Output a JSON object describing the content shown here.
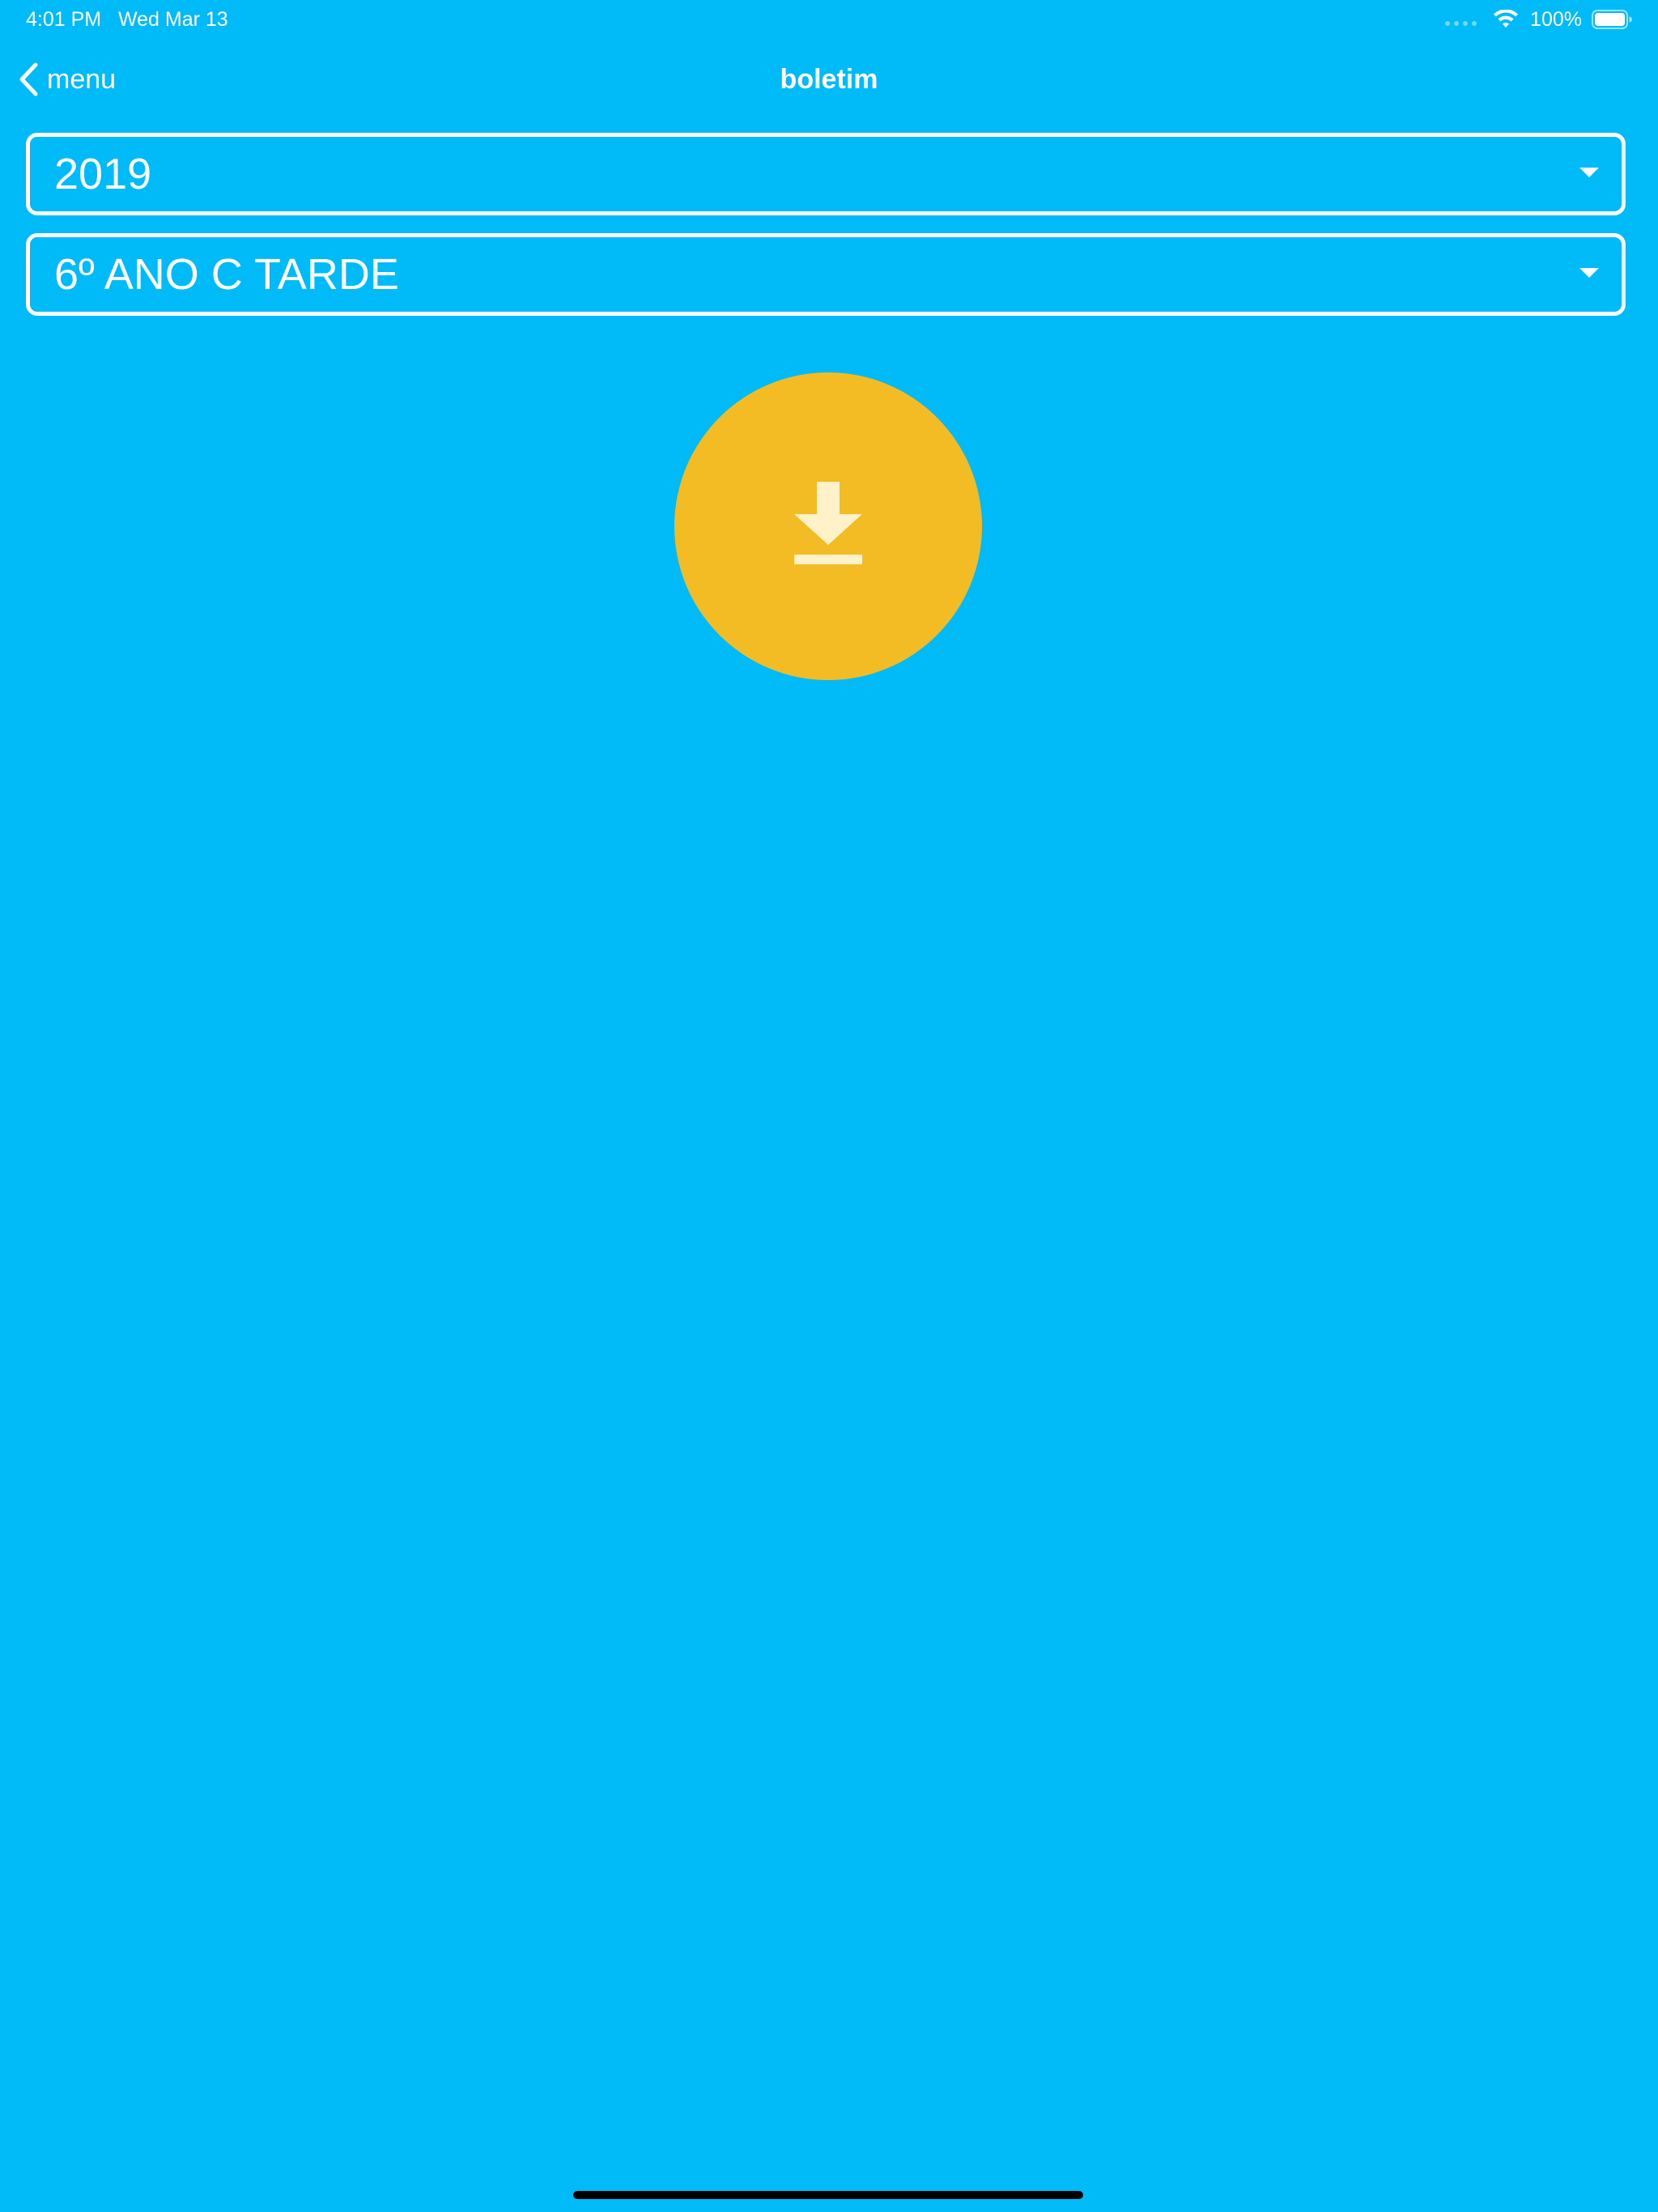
{
  "status_bar": {
    "time": "4:01 PM",
    "date": "Wed Mar 13",
    "battery_percent": "100%",
    "icons": [
      "signal-icon",
      "wifi-icon",
      "battery-icon"
    ]
  },
  "nav": {
    "back_label": "menu",
    "title": "boletim"
  },
  "filters": {
    "year": "2019",
    "class": "6º ANO C TARDE"
  },
  "actions": {
    "download_icon": "download-icon"
  },
  "colors": {
    "background": "#01BAF8",
    "download_button": "#F4BC24",
    "foreground": "#FFFFFF"
  }
}
